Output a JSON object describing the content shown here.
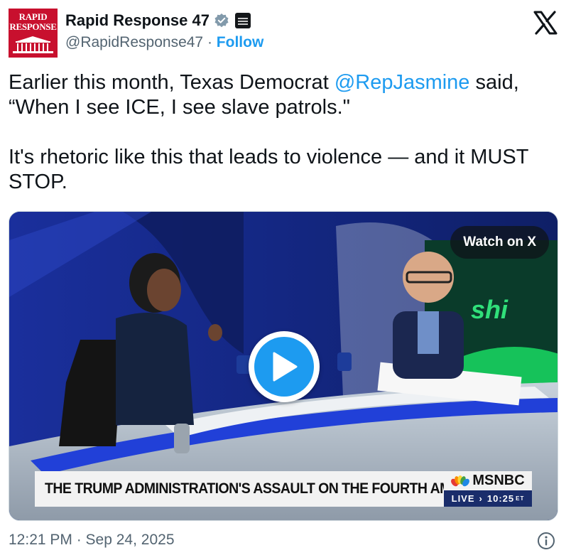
{
  "author": {
    "avatar_text_line1": "RAPID",
    "avatar_text_line2": "RESPONSE",
    "name": "Rapid Response 47",
    "handle": "@RapidResponse47",
    "separator": "·",
    "follow_label": "Follow",
    "verified_icon": "verified-badge-icon",
    "affiliation_icon": "affiliate-badge-icon"
  },
  "platform_icon": "x-logo-icon",
  "tweet": {
    "paragraph1_before": "Earlier this month, Texas Democrat ",
    "mention": "@RepJasmine",
    "paragraph1_after": " said, “When I see ICE, I see slave patrols.\"",
    "paragraph2": "It's rhetoric like this that leads to violence — and it MUST STOP."
  },
  "media": {
    "watch_label": "Watch on X",
    "play_icon": "play-icon",
    "backdrop_text": "shi",
    "chyron": "THE TRUMP ADMINISTRATION'S ASSAULT ON THE FOURTH AMENDMENT",
    "network": "MSNBC",
    "live_label": "LIVE",
    "live_arrow": "›",
    "live_time": "10:25",
    "live_tz": "ET"
  },
  "footer": {
    "timestamp": "12:21 PM · Sep 24, 2025",
    "info_icon": "info-icon"
  },
  "colors": {
    "accent": "#1d9bf0",
    "text": "#0f1419",
    "muted": "#536471",
    "avatar_red": "#c8102e"
  }
}
